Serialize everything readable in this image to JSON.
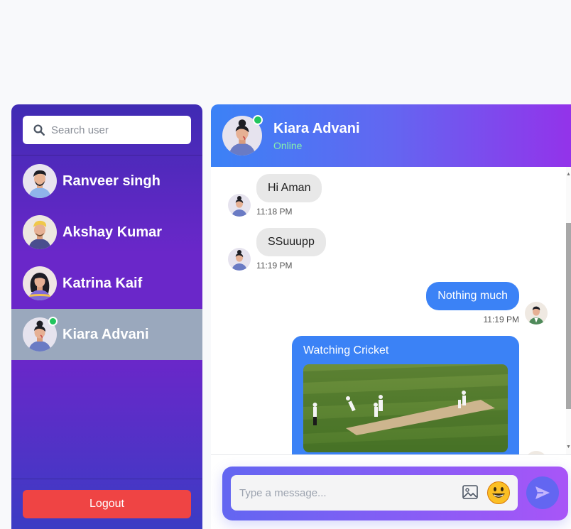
{
  "sidebar": {
    "search": {
      "placeholder": "Search user"
    },
    "users": [
      {
        "name": "Ranveer singh",
        "online": false,
        "active": false
      },
      {
        "name": "Akshay Kumar",
        "online": false,
        "active": false
      },
      {
        "name": "Katrina Kaif",
        "online": false,
        "active": false
      },
      {
        "name": "Kiara Advani",
        "online": true,
        "active": true
      }
    ],
    "logout_label": "Logout"
  },
  "chat": {
    "header": {
      "name": "Kiara Advani",
      "status": "Online"
    },
    "messages": [
      {
        "direction": "incoming",
        "text": "Hi Aman",
        "time": "11:18 PM"
      },
      {
        "direction": "incoming",
        "text": "SSuuupp",
        "time": "11:19 PM"
      },
      {
        "direction": "outgoing",
        "text": "Nothing much",
        "time": "11:19 PM"
      },
      {
        "direction": "outgoing",
        "type": "image",
        "caption": "Watching Cricket",
        "image": "cricket-match-photo"
      }
    ],
    "composer": {
      "placeholder": "Type a message..."
    }
  },
  "icons": {
    "search": "search-icon",
    "image": "image-icon",
    "emoji": "emoji-icon",
    "send": "send-icon"
  },
  "colors": {
    "sidebar_top": "#3f2bb3",
    "sidebar_mid": "#6a27c9",
    "active_item": "#9aa8bd",
    "online": "#22c55e",
    "logout": "#ef4444",
    "outgoing_bubble": "#3b82f6",
    "incoming_bubble": "#e8e8e8",
    "header_start": "#3b82f6",
    "header_end": "#9333ea"
  }
}
